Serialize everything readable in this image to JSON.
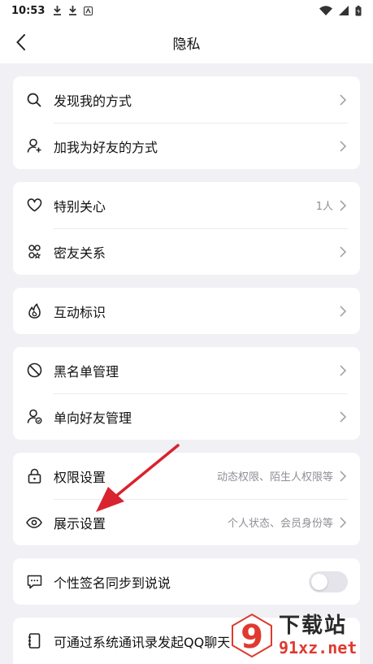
{
  "status_bar": {
    "time": "10:53"
  },
  "nav": {
    "title": "隐私"
  },
  "sections": [
    {
      "rows": [
        {
          "label": "发现我的方式",
          "icon": "search-icon"
        },
        {
          "label": "加我为好友的方式",
          "icon": "add-user-icon"
        }
      ]
    },
    {
      "rows": [
        {
          "label": "特别关心",
          "value": "1人",
          "icon": "heart-icon"
        },
        {
          "label": "密友关系",
          "icon": "close-friends-icon"
        }
      ]
    },
    {
      "rows": [
        {
          "label": "互动标识",
          "icon": "flame-icon"
        }
      ]
    },
    {
      "rows": [
        {
          "label": "黑名单管理",
          "icon": "block-icon"
        },
        {
          "label": "单向好友管理",
          "icon": "one-way-friend-icon"
        }
      ]
    },
    {
      "rows": [
        {
          "label": "权限设置",
          "value": "动态权限、陌生人权限等",
          "icon": "lock-icon"
        },
        {
          "label": "展示设置",
          "value": "个人状态、会员身份等",
          "icon": "eye-icon"
        }
      ]
    },
    {
      "rows": [
        {
          "label": "个性签名同步到说说",
          "icon": "signature-icon",
          "toggle": false
        }
      ]
    },
    {
      "rows": [
        {
          "label": "可通过系统通讯录发起QQ聊天",
          "icon": "contacts-icon"
        }
      ]
    }
  ],
  "watermark": {
    "big": "下载站",
    "small": "91xz.net",
    "logo_digit": "9"
  },
  "colors": {
    "background": "#f0f0f5",
    "card": "#ffffff",
    "annotation_arrow": "#d9232e",
    "watermark_red": "#e03a2f"
  }
}
